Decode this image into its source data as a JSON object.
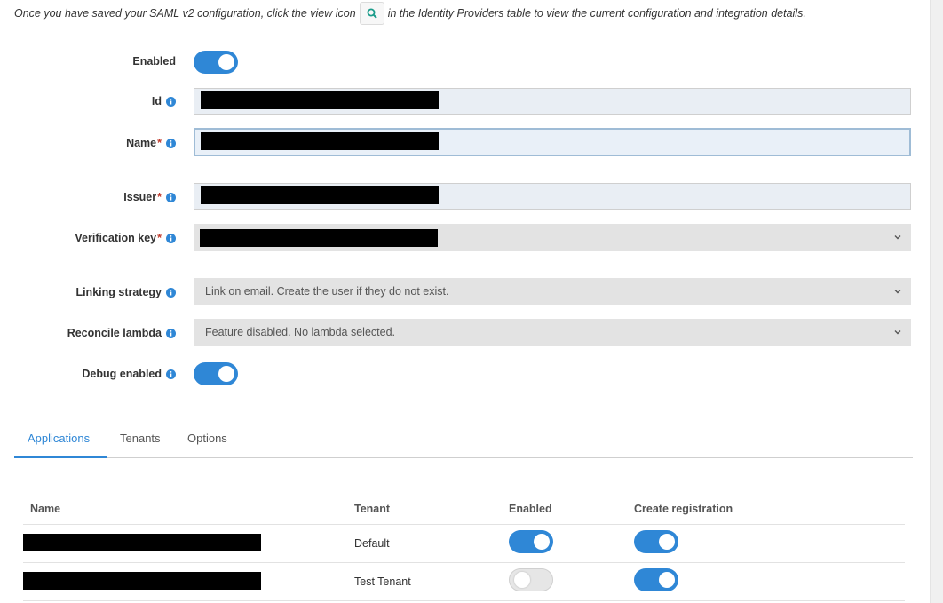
{
  "intro": {
    "before": "Once you have saved your SAML v2 configuration, click the view icon",
    "after": "in the Identity Providers table to view the current configuration and integration details."
  },
  "form": {
    "enabled": {
      "label": "Enabled",
      "on": true
    },
    "id": {
      "label": "Id"
    },
    "name": {
      "label": "Name",
      "required": "*"
    },
    "issuer": {
      "label": "Issuer",
      "required": "*"
    },
    "verification_key": {
      "label": "Verification key",
      "required": "*"
    },
    "linking_strategy": {
      "label": "Linking strategy",
      "value": "Link on email. Create the user if they do not exist."
    },
    "reconcile_lambda": {
      "label": "Reconcile lambda",
      "value": "Feature disabled. No lambda selected."
    },
    "debug_enabled": {
      "label": "Debug enabled",
      "on": true
    }
  },
  "tabs": [
    "Applications",
    "Tenants",
    "Options"
  ],
  "applications_table": {
    "columns": [
      "Name",
      "Tenant",
      "Enabled",
      "Create registration"
    ],
    "rows": [
      {
        "tenant": "Default",
        "enabled": true,
        "create_registration": true
      },
      {
        "tenant": "Test Tenant",
        "enabled": false,
        "create_registration": true
      }
    ]
  },
  "colors": {
    "accent": "#2f87d6",
    "required": "#c0392b",
    "view_icon": "#1a9c8a"
  },
  "icons": {
    "view": "search-icon",
    "info": "info-icon",
    "select": "chevron-down-icon"
  }
}
